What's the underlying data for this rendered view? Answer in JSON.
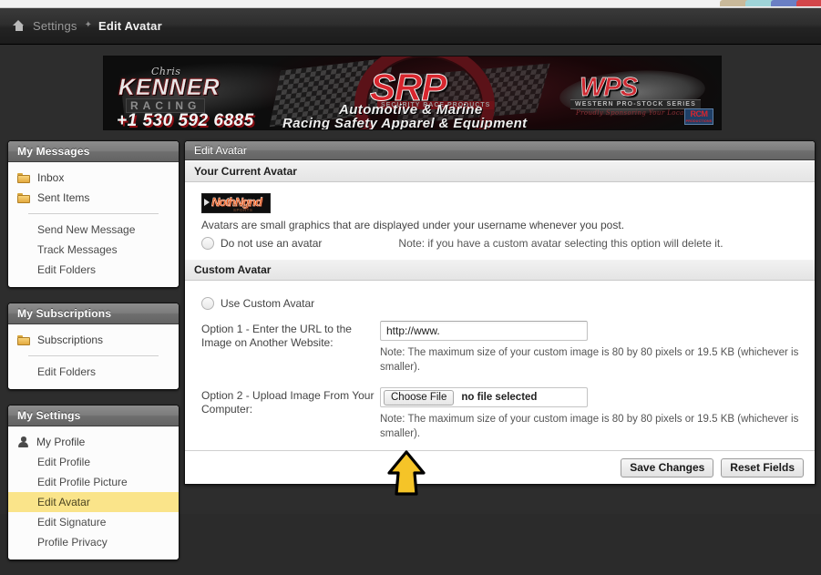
{
  "browser": {
    "tab_colors": [
      "#c9b99a",
      "#9fd4d8",
      "#6a7fc4",
      "#d3464a"
    ]
  },
  "breadcrumb": {
    "home_icon": "home-icon",
    "items": [
      {
        "label": "Settings",
        "current": false
      },
      {
        "label": "Edit Avatar",
        "current": true
      }
    ],
    "separator": "✦"
  },
  "banner": {
    "kenner_script": "Chris",
    "kenner_main": "KENNER",
    "kenner_racing": "RACING",
    "kenner_phone": "+1 530 592 6885",
    "srp_main": "SRP",
    "srp_sub": "SECURITY RACE PRODUCTS",
    "srp_line1": "Automotive & Marine",
    "srp_line2": "Racing Safety Apparel & Equipment",
    "wps_main": "WPS",
    "wps_sub": "WESTERN PRO-STOCK SERIES",
    "wps_tag": "Proudly Sponsoring Your Local Racing",
    "rcm_badge": "RCM",
    "rcm_sub": "PRODUCTIONS"
  },
  "sidebar": {
    "panels": [
      {
        "title": "My Messages",
        "items": [
          {
            "label": "Inbox",
            "icon": "folder-icon",
            "type": "folder"
          },
          {
            "label": "Sent Items",
            "icon": "folder-icon",
            "type": "folder"
          },
          {
            "type": "divider"
          },
          {
            "label": "Send New Message",
            "type": "sub"
          },
          {
            "label": "Track Messages",
            "type": "sub"
          },
          {
            "label": "Edit Folders",
            "type": "sub"
          }
        ]
      },
      {
        "title": "My Subscriptions",
        "items": [
          {
            "label": "Subscriptions",
            "icon": "folder-icon",
            "type": "folder"
          },
          {
            "type": "divider"
          },
          {
            "label": "Edit Folders",
            "type": "sub"
          }
        ]
      },
      {
        "title": "My Settings",
        "items": [
          {
            "label": "My Profile",
            "icon": "person-icon",
            "type": "person"
          },
          {
            "label": "Edit Profile",
            "type": "sub"
          },
          {
            "label": "Edit Profile Picture",
            "type": "sub"
          },
          {
            "label": "Edit Avatar",
            "type": "sub",
            "active": true
          },
          {
            "label": "Edit Signature",
            "type": "sub"
          },
          {
            "label": "Profile Privacy",
            "type": "sub"
          }
        ]
      }
    ]
  },
  "main": {
    "title": "Edit Avatar",
    "section_current": {
      "title": "Your Current Avatar",
      "avatar_alt": "Nothing Racing logo avatar",
      "avatar_logo_text": "NothNgnd",
      "avatar_logo_sub": "RACING SPORTS",
      "description": "Avatars are small graphics that are displayed under your username whenever you post.",
      "option_no_avatar": "Do not use an avatar",
      "option_no_avatar_note": "Note: if you have a custom avatar selecting this option will delete it."
    },
    "section_custom": {
      "title": "Custom Avatar",
      "option_use_custom": "Use Custom Avatar",
      "option1_label": "Option 1 - Enter the URL to the Image on Another Website:",
      "option1_value": "http://www.",
      "option1_note": "Note: The maximum size of your custom image is 80 by 80 pixels or 19.5 KB (whichever is smaller).",
      "option2_label": "Option 2 - Upload Image From Your Computer:",
      "option2_button": "Choose File",
      "option2_filename": "no file selected",
      "option2_note": "Note: The maximum size of your custom image is 80 by 80 pixels or 19.5 KB (whichever is smaller)."
    },
    "footer": {
      "save_label": "Save Changes",
      "reset_label": "Reset Fields"
    }
  },
  "cursor": {
    "type": "arrow-up-cursor",
    "fill": "#f5c428",
    "stroke": "#000000"
  }
}
